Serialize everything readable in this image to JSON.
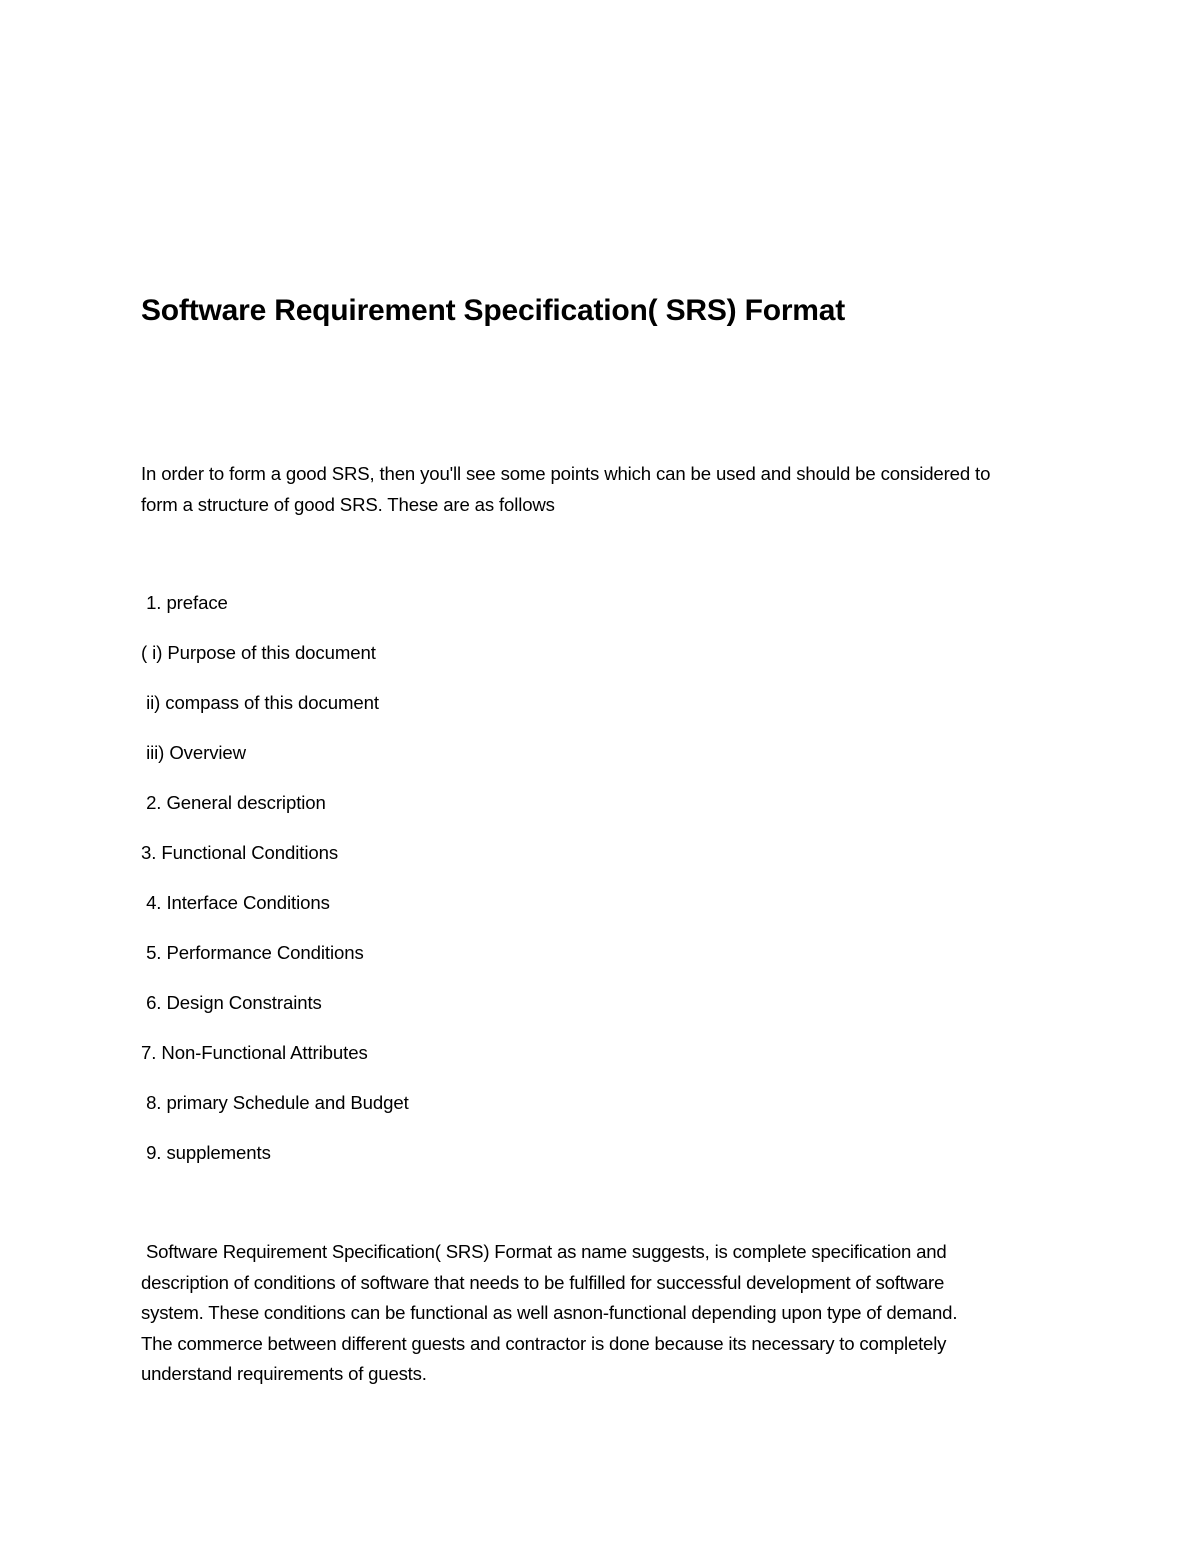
{
  "document": {
    "title": "Software Requirement Specification( SRS) Format",
    "intro_lines": [
      "In order to form a good SRS, then you'll see some points which can be used and should be considered to",
      "form a structure of good SRS. These are as follows"
    ],
    "outline": [
      " 1. preface",
      "( i) Purpose of this document",
      " ii) compass of this document",
      " iii) Overview",
      " 2. General description",
      "3. Functional Conditions",
      " 4. Interface Conditions",
      " 5. Performance Conditions",
      " 6. Design Constraints",
      "7. Non-Functional Attributes",
      " 8. primary Schedule and Budget",
      " 9. supplements"
    ],
    "closing_lines": [
      " Software Requirement Specification( SRS) Format as name suggests, is complete specification and",
      "description of conditions of software that needs to be fulfilled for successful development of software",
      "system. These conditions can be functional as well asnon-functional depending upon type of demand.",
      "The commerce between different guests and contractor is done because its necessary to completely",
      "understand requirements of guests."
    ]
  }
}
